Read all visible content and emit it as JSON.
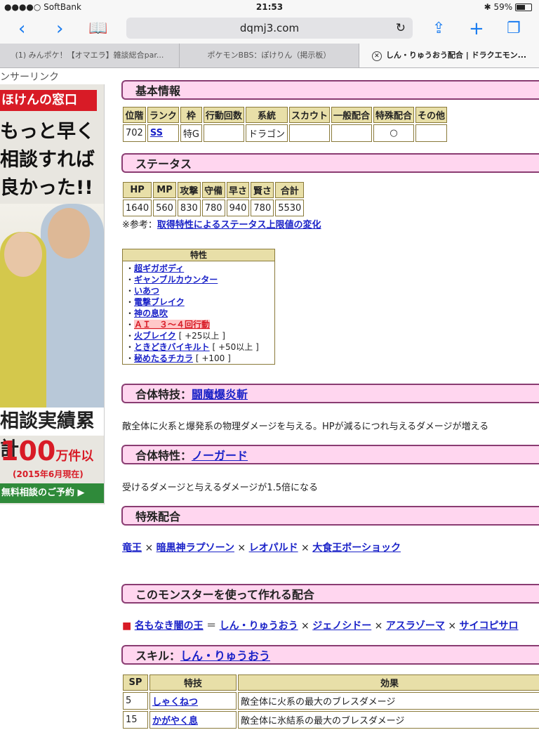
{
  "status": {
    "carrier": "●●●●○ SoftBank",
    "time": "21:53",
    "battery": "59%",
    "battery_level": 0.59
  },
  "browser": {
    "url": "dqmj3.com"
  },
  "tabs": [
    {
      "label": "(1) みんポケ！【オマエラ】雑談総合par..."
    },
    {
      "label": "ポケモンBBS：ぽけりん（掲示板）"
    },
    {
      "label": "しん・りゅうおう配合 | ドラクエモン..."
    }
  ],
  "ad": {
    "sponsor": "ンサーリンク",
    "banner": "ほけんの窓口",
    "line1": "もっと早く",
    "line2": "相談すれば",
    "line3": "良かった!!",
    "line4": "相談実績累計",
    "count": "100",
    "count_unit": "万件以上",
    "date": "(2015年6月現在)",
    "cta": "無料相談のご予約 ▶"
  },
  "basic": {
    "title": "基本情報",
    "headers": [
      "位階",
      "ランク",
      "枠",
      "行動回数",
      "系統",
      "スカウト",
      "一般配合",
      "特殊配合",
      "その他"
    ],
    "values": [
      "702",
      "SS",
      "特G",
      "",
      "ドラゴン",
      "",
      "",
      "○",
      ""
    ]
  },
  "status_sec": {
    "title": "ステータス",
    "headers": [
      "HP",
      "MP",
      "攻撃",
      "守備",
      "早さ",
      "賢さ",
      "合計"
    ],
    "values": [
      "1640",
      "560",
      "830",
      "780",
      "940",
      "780",
      "5530"
    ],
    "note_prefix": "※参考：",
    "note_link": "取得特性によるステータス上限値の変化"
  },
  "traits": {
    "title": "特性",
    "items": [
      {
        "name": "超ギガボディ",
        "extra": ""
      },
      {
        "name": "ギャンブルカウンター",
        "extra": ""
      },
      {
        "name": "いあつ",
        "extra": ""
      },
      {
        "name": "電撃ブレイク",
        "extra": ""
      },
      {
        "name": "神の息吹",
        "extra": ""
      },
      {
        "name": "ＡＩ　３～４回行動",
        "extra": ""
      },
      {
        "name": "火ブレイク",
        "extra": "[ +25以上 ]"
      },
      {
        "name": "ときどきバイキルト",
        "extra": "[ +50以上 ]"
      },
      {
        "name": "秘めたるチカラ",
        "extra": "[ +100 ]"
      }
    ]
  },
  "gattai_skill": {
    "label": "合体特技：",
    "name": "闘魔爆炎斬",
    "desc": "敵全体に火系と爆発系の物理ダメージを与える。HPが減るにつれ与えるダメージが増える"
  },
  "gattai_trait": {
    "label": "合体特性：",
    "name": "ノーガード",
    "desc": "受けるダメージと与えるダメージが1.5倍になる"
  },
  "special": {
    "title": "特殊配合",
    "parts": [
      "竜王",
      "暗黒神ラプソーン",
      "レオパルド",
      "大食王ボーショック"
    ],
    "sep": "×"
  },
  "uses": {
    "title": "このモンスターを使って作れる配合",
    "result": "名もなき闇の王",
    "eq": "＝",
    "parts": [
      "しん・りゅうおう",
      "ジェノシドー",
      "アスラゾーマ",
      "サイコピサロ"
    ],
    "sep": "×"
  },
  "skill": {
    "label": "スキル：",
    "name": "しん・りゅうおう",
    "headers": [
      "SP",
      "特技",
      "効果"
    ],
    "rows": [
      {
        "sp": "5",
        "move": "しゃくねつ",
        "effect": "敵全体に火系の最大のブレスダメージ"
      },
      {
        "sp": "15",
        "move": "かがやく息",
        "effect": "敵全体に氷結系の最大のブレスダメージ"
      }
    ]
  },
  "colors": {
    "accent": "#1a7cf0",
    "section_bg": "#ffd6ef",
    "section_border": "#8a3c72",
    "link": "#1a22c8"
  }
}
